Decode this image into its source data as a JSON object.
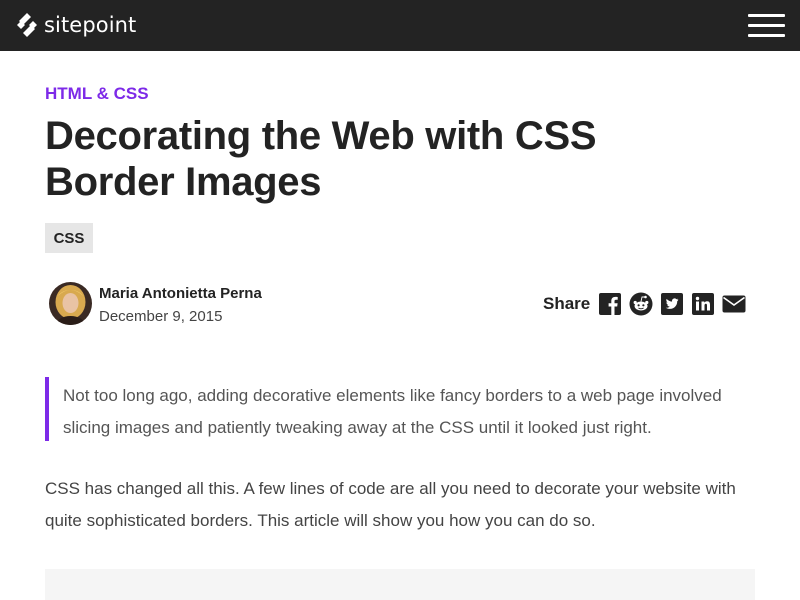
{
  "header": {
    "logo_text": "sitepoint",
    "menu_icon": "hamburger-menu-icon"
  },
  "article": {
    "category": "HTML & CSS",
    "title_line1": "Decorating the Web with CSS",
    "title_line2": "Border Images",
    "tag": "CSS",
    "author": {
      "name": "Maria Antonietta Perna",
      "date": "December 9, 2015"
    },
    "share": {
      "label": "Share",
      "icons": [
        "facebook-icon",
        "reddit-icon",
        "twitter-icon",
        "linkedin-icon",
        "email-icon"
      ]
    },
    "intro_quote": "Not too long ago, adding decorative elements like fancy borders to a web page involved slicing images and patiently tweaking away at the CSS until it looked just right.",
    "paragraph_1": "CSS has changed all this. A few lines of code are all you need to decorate your website with quite sophisticated borders. This article will show you how you can do so."
  },
  "colors": {
    "header_bg": "#232323",
    "accent": "#7d2ae8",
    "tag_bg": "#e6e6e6",
    "code_bg": "#f5f5f5"
  }
}
